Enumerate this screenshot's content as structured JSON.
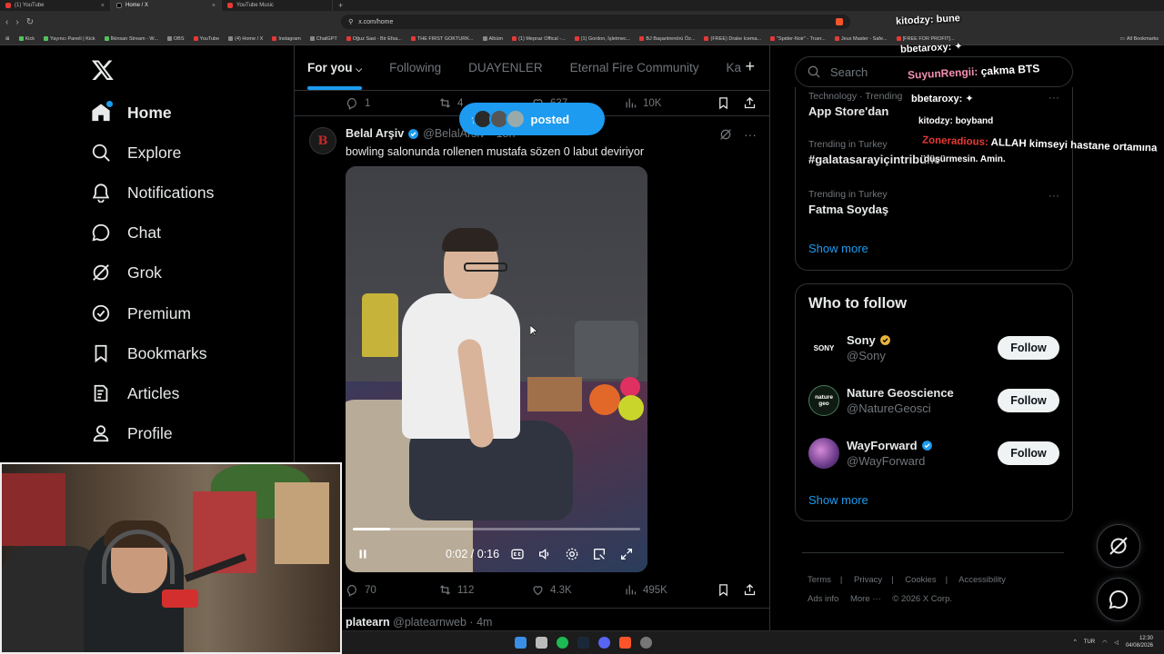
{
  "browser": {
    "tabs": [
      {
        "label": "(1) YouTube",
        "favicon": "youtube"
      },
      {
        "label": "Home / X",
        "favicon": "x"
      },
      {
        "label": "YouTube Music",
        "favicon": "youtube"
      }
    ],
    "url": "x.com/home",
    "bookmarks": [
      "Kick",
      "Yayıncı Paneli | Kick",
      "İlkinsan Stream - W...",
      "OBS",
      "YouTube",
      "(4) Home / X",
      "Instagram",
      "ChatGPT",
      "Oğuz Sasi - Bir Efsa...",
      "THE FIRST GOKTURK...",
      "Albüm",
      "(1) Mepraz Offical -...",
      "(1) Gordon, İşletmec...",
      "BJ Başantrenörü Öz...",
      "(FREE) Drake Icema...",
      "\"Spider-Noir\" - Truer...",
      "Jeux Master - Safe...",
      "[FREE FOR PROFIT]..."
    ],
    "all_bookmarks": "All Bookmarks"
  },
  "nav": {
    "items": [
      {
        "label": "Home",
        "icon": "home-icon"
      },
      {
        "label": "Explore",
        "icon": "search-icon"
      },
      {
        "label": "Notifications",
        "icon": "bell-icon"
      },
      {
        "label": "Chat",
        "icon": "chat-icon"
      },
      {
        "label": "Grok",
        "icon": "grok-icon"
      },
      {
        "label": "Premium",
        "icon": "verified-icon"
      },
      {
        "label": "Bookmarks",
        "icon": "bookmark-icon"
      },
      {
        "label": "Articles",
        "icon": "article-icon"
      },
      {
        "label": "Profile",
        "icon": "person-icon"
      }
    ]
  },
  "feed": {
    "tabs": [
      "For you",
      "Following",
      "DUAYENLER",
      "Eternal Fire Community",
      "Ka"
    ],
    "prev_actions": {
      "replies": "1",
      "reposts": "4",
      "likes": "637",
      "views": "10K"
    },
    "posted_pill": "posted",
    "tweet": {
      "name": "Belal Arşiv",
      "handle": "@BelalArsiv",
      "time": "18h",
      "text": "bowling salonunda rollenen mustafa sözen 0 labut deviriyor",
      "video_time": "0:02 / 0:16",
      "video_progress": 0.13,
      "replies": "70",
      "reposts": "112",
      "likes": "4.3K",
      "views": "495K"
    },
    "next_tweet": {
      "name": "platearn",
      "handle": "@platearnweb",
      "time": "4m"
    }
  },
  "right": {
    "search_placeholder": "Search",
    "trends": [
      {
        "category": "Technology · Trending",
        "name": "App Store'dan"
      },
      {
        "category": "Trending in Turkey",
        "name": "#galatasarayiçintribüne"
      },
      {
        "category": "Trending in Turkey",
        "name": "Fatma Soydaş"
      }
    ],
    "show_more": "Show more",
    "who_to_follow": {
      "title": "Who to follow",
      "accounts": [
        {
          "name": "Sony",
          "handle": "@Sony",
          "badge": "gold",
          "avatar_text": "SONY"
        },
        {
          "name": "Nature Geoscience",
          "handle": "@NatureGeosci",
          "badge": "",
          "avatar_text": "nature geo"
        },
        {
          "name": "WayForward",
          "handle": "@WayForward",
          "badge": "blue",
          "avatar_text": ""
        }
      ],
      "follow_label": "Follow",
      "show_more": "Show more"
    },
    "footer": {
      "links_row1": [
        "Terms",
        "Privacy",
        "Cookies",
        "Accessibility"
      ],
      "links_row2": [
        "Ads info",
        "More ···",
        "© 2026 X Corp."
      ]
    }
  },
  "chat_overlay": [
    {
      "user": "kitodzy:",
      "msg": "bune"
    },
    {
      "user": "bbetaroxy:",
      "msg": ""
    },
    {
      "user": "SuyunRengii:",
      "msg": "çakma BTS"
    },
    {
      "user": "bbetaroxy:",
      "msg": ""
    },
    {
      "user": "kitodzy:",
      "msg": "boyband"
    },
    {
      "user": "Zoneradious:",
      "msg": "ALLAH kimseyi hastane ortamına"
    },
    {
      "user": "",
      "msg": "düşürmesin. Amin."
    }
  ],
  "taskbar": {
    "lang": "TUR",
    "time": "12:30",
    "date": "04/08/2026"
  },
  "colors": {
    "accent": "#1d9bf0",
    "bg": "#000000",
    "border": "#2f3336",
    "muted": "#71767b"
  }
}
